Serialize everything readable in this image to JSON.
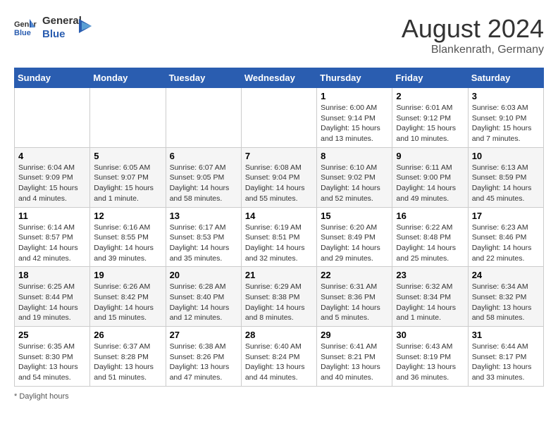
{
  "header": {
    "logo": {
      "general": "General",
      "blue": "Blue"
    },
    "month": "August 2024",
    "location": "Blankenrath, Germany"
  },
  "days_of_week": [
    "Sunday",
    "Monday",
    "Tuesday",
    "Wednesday",
    "Thursday",
    "Friday",
    "Saturday"
  ],
  "weeks": [
    [
      {
        "day": "",
        "info": ""
      },
      {
        "day": "",
        "info": ""
      },
      {
        "day": "",
        "info": ""
      },
      {
        "day": "",
        "info": ""
      },
      {
        "day": "1",
        "info": "Sunrise: 6:00 AM\nSunset: 9:14 PM\nDaylight: 15 hours\nand 13 minutes."
      },
      {
        "day": "2",
        "info": "Sunrise: 6:01 AM\nSunset: 9:12 PM\nDaylight: 15 hours\nand 10 minutes."
      },
      {
        "day": "3",
        "info": "Sunrise: 6:03 AM\nSunset: 9:10 PM\nDaylight: 15 hours\nand 7 minutes."
      }
    ],
    [
      {
        "day": "4",
        "info": "Sunrise: 6:04 AM\nSunset: 9:09 PM\nDaylight: 15 hours\nand 4 minutes."
      },
      {
        "day": "5",
        "info": "Sunrise: 6:05 AM\nSunset: 9:07 PM\nDaylight: 15 hours\nand 1 minute."
      },
      {
        "day": "6",
        "info": "Sunrise: 6:07 AM\nSunset: 9:05 PM\nDaylight: 14 hours\nand 58 minutes."
      },
      {
        "day": "7",
        "info": "Sunrise: 6:08 AM\nSunset: 9:04 PM\nDaylight: 14 hours\nand 55 minutes."
      },
      {
        "day": "8",
        "info": "Sunrise: 6:10 AM\nSunset: 9:02 PM\nDaylight: 14 hours\nand 52 minutes."
      },
      {
        "day": "9",
        "info": "Sunrise: 6:11 AM\nSunset: 9:00 PM\nDaylight: 14 hours\nand 49 minutes."
      },
      {
        "day": "10",
        "info": "Sunrise: 6:13 AM\nSunset: 8:59 PM\nDaylight: 14 hours\nand 45 minutes."
      }
    ],
    [
      {
        "day": "11",
        "info": "Sunrise: 6:14 AM\nSunset: 8:57 PM\nDaylight: 14 hours\nand 42 minutes."
      },
      {
        "day": "12",
        "info": "Sunrise: 6:16 AM\nSunset: 8:55 PM\nDaylight: 14 hours\nand 39 minutes."
      },
      {
        "day": "13",
        "info": "Sunrise: 6:17 AM\nSunset: 8:53 PM\nDaylight: 14 hours\nand 35 minutes."
      },
      {
        "day": "14",
        "info": "Sunrise: 6:19 AM\nSunset: 8:51 PM\nDaylight: 14 hours\nand 32 minutes."
      },
      {
        "day": "15",
        "info": "Sunrise: 6:20 AM\nSunset: 8:49 PM\nDaylight: 14 hours\nand 29 minutes."
      },
      {
        "day": "16",
        "info": "Sunrise: 6:22 AM\nSunset: 8:48 PM\nDaylight: 14 hours\nand 25 minutes."
      },
      {
        "day": "17",
        "info": "Sunrise: 6:23 AM\nSunset: 8:46 PM\nDaylight: 14 hours\nand 22 minutes."
      }
    ],
    [
      {
        "day": "18",
        "info": "Sunrise: 6:25 AM\nSunset: 8:44 PM\nDaylight: 14 hours\nand 19 minutes."
      },
      {
        "day": "19",
        "info": "Sunrise: 6:26 AM\nSunset: 8:42 PM\nDaylight: 14 hours\nand 15 minutes."
      },
      {
        "day": "20",
        "info": "Sunrise: 6:28 AM\nSunset: 8:40 PM\nDaylight: 14 hours\nand 12 minutes."
      },
      {
        "day": "21",
        "info": "Sunrise: 6:29 AM\nSunset: 8:38 PM\nDaylight: 14 hours\nand 8 minutes."
      },
      {
        "day": "22",
        "info": "Sunrise: 6:31 AM\nSunset: 8:36 PM\nDaylight: 14 hours\nand 5 minutes."
      },
      {
        "day": "23",
        "info": "Sunrise: 6:32 AM\nSunset: 8:34 PM\nDaylight: 14 hours\nand 1 minute."
      },
      {
        "day": "24",
        "info": "Sunrise: 6:34 AM\nSunset: 8:32 PM\nDaylight: 13 hours\nand 58 minutes."
      }
    ],
    [
      {
        "day": "25",
        "info": "Sunrise: 6:35 AM\nSunset: 8:30 PM\nDaylight: 13 hours\nand 54 minutes."
      },
      {
        "day": "26",
        "info": "Sunrise: 6:37 AM\nSunset: 8:28 PM\nDaylight: 13 hours\nand 51 minutes."
      },
      {
        "day": "27",
        "info": "Sunrise: 6:38 AM\nSunset: 8:26 PM\nDaylight: 13 hours\nand 47 minutes."
      },
      {
        "day": "28",
        "info": "Sunrise: 6:40 AM\nSunset: 8:24 PM\nDaylight: 13 hours\nand 44 minutes."
      },
      {
        "day": "29",
        "info": "Sunrise: 6:41 AM\nSunset: 8:21 PM\nDaylight: 13 hours\nand 40 minutes."
      },
      {
        "day": "30",
        "info": "Sunrise: 6:43 AM\nSunset: 8:19 PM\nDaylight: 13 hours\nand 36 minutes."
      },
      {
        "day": "31",
        "info": "Sunrise: 6:44 AM\nSunset: 8:17 PM\nDaylight: 13 hours\nand 33 minutes."
      }
    ]
  ],
  "footer": {
    "note": "Daylight hours"
  }
}
